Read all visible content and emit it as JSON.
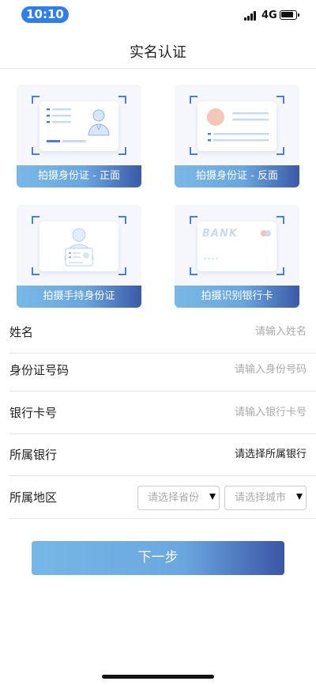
{
  "status_bar": {
    "time": "10:10",
    "network": "4G"
  },
  "nav": {
    "title": "实名认证"
  },
  "cards": [
    {
      "label": "拍摄身份证 - 正面"
    },
    {
      "label": "拍摄身份证 - 反面"
    },
    {
      "label": "拍摄手持身份证"
    },
    {
      "label": "拍摄识别银行卡",
      "card_text": "BANK"
    }
  ],
  "form": {
    "name": {
      "label": "姓名",
      "placeholder": "请输入姓名"
    },
    "id_number": {
      "label": "身份证号码",
      "placeholder": "请输入身份号码"
    },
    "bank_card": {
      "label": "银行卡号",
      "placeholder": "请输入银行卡号"
    },
    "bank": {
      "label": "所属银行",
      "value": "请选择所属银行"
    },
    "region": {
      "label": "所属地区",
      "province_placeholder": "请选择省份",
      "city_placeholder": "请选择城市"
    }
  },
  "next_button": {
    "label": "下一步"
  },
  "colors": {
    "accent": "#2d7ff0",
    "gradient_start": "#79b8e6",
    "gradient_end": "#3b5aa8",
    "corner": "#4a7fe0"
  }
}
